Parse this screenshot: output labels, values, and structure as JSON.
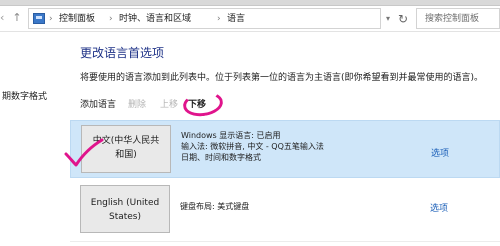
{
  "address_bar": {
    "crumbs": [
      "控制面板",
      "时钟、语言和区域",
      "语言"
    ],
    "search_placeholder": "搜索控制面板"
  },
  "left_pane": {
    "link": "期数字格式"
  },
  "main": {
    "title": "更改语言首选项",
    "description": "将要使用的语言添加到此列表中。位于列表第一位的语言为主语言(即你希望看到并最常使用的语言)。",
    "toolbar": {
      "add": "添加语言",
      "delete": "删除",
      "move_up": "上移",
      "move_down": "下移"
    },
    "languages": [
      {
        "name_line1": "中文(中华人民共",
        "name_line2": "和国)",
        "info": [
          "Windows 显示语言: 已启用",
          "输入法: 微软拼音, 中文 - QQ五笔输入法",
          "日期、时间和数字格式"
        ],
        "options": "选项"
      },
      {
        "name_line1": "English (United",
        "name_line2": "States)",
        "info": [
          "键盘布局: 美式键盘"
        ],
        "options": "选项"
      }
    ]
  },
  "colors": {
    "title": "#1e3287",
    "link": "#1b5fb8",
    "selected_row": "#cfe6f9",
    "annotation": "#e0148c"
  }
}
